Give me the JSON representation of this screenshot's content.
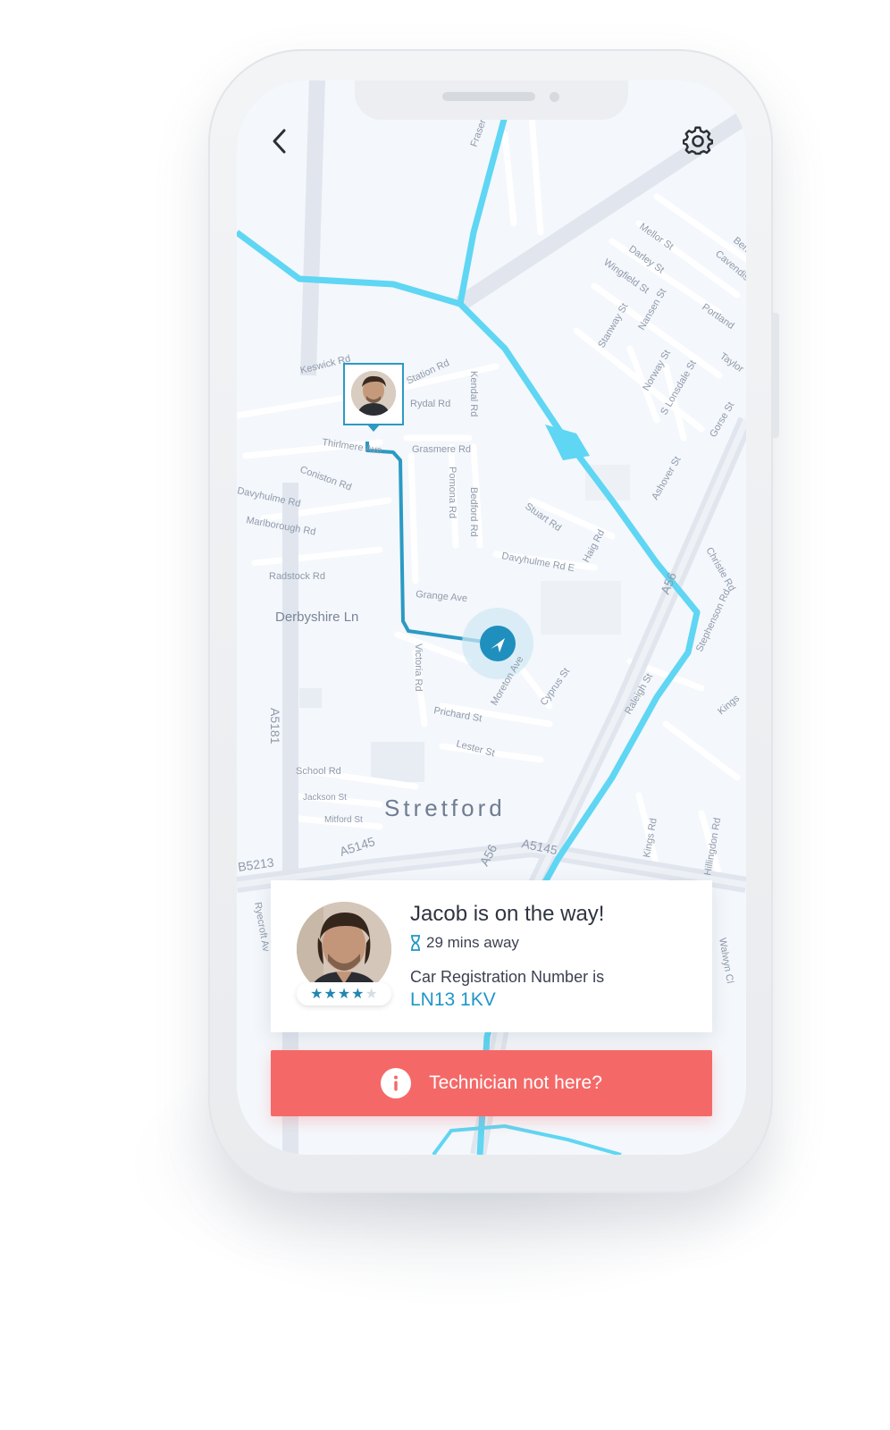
{
  "app": {
    "theme": {
      "accent": "#1f96c7",
      "route": "#2b9ac4",
      "alert": "#f46968",
      "waterway": "#5fd6f3"
    }
  },
  "header": {
    "back_icon": "chevron-left-icon",
    "settings_icon": "gear-icon"
  },
  "map": {
    "area_label": "Stretford",
    "labels": [
      "Keswick Rd",
      "Station Rd",
      "Rydal Rd",
      "Kendal Rd",
      "Thirlmere Ave",
      "Grasmere Rd",
      "Coniston Rd",
      "Davyhulme Rd",
      "Marlborough Rd",
      "Pomona Rd",
      "Bedford Rd",
      "Stuart Rd",
      "Davyhulme Rd E",
      "Haig Rd",
      "Radstock Rd",
      "Grange Ave",
      "Derbyshire Ln",
      "A56",
      "A5181",
      "Victoria Rd",
      "Moreton Ave",
      "Cyprus St",
      "Prichard St",
      "Lester St",
      "School Rd",
      "Jackson St",
      "Mitford St",
      "A5145",
      "B5213",
      "Mellor St",
      "Darley St",
      "Wingfield St",
      "Nansen St",
      "Stanway St",
      "Norway St",
      "Portland",
      "Taylor",
      "S Lonsdale St",
      "Gorse St",
      "Ashover St",
      "Christie Rd",
      "Stephenson Rd",
      "Raleigh St",
      "Kings Rd",
      "Hillingdon Rd",
      "Walwyn Cl",
      "Ryecroft Av",
      "Cavendish",
      "Fraser",
      "Ben",
      "Kings"
    ]
  },
  "driver": {
    "title": "Jacob is on the way!",
    "eta": "29 mins away",
    "eta_icon": "hourglass-icon",
    "registration_label": "Car Registration Number is",
    "registration_value": "LN13 1KV",
    "rating": 4,
    "rating_max": 5
  },
  "actions": {
    "not_here_label": "Technician not here?",
    "not_here_icon": "info-icon"
  }
}
